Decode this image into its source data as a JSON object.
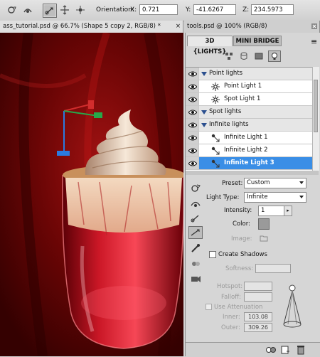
{
  "options_bar": {
    "orientation_label": "Orientation:",
    "x_label": "X:",
    "x_value": "0.721",
    "y_label": "Y:",
    "y_value": "-41.6267",
    "z_label": "Z:",
    "z_value": "234.5973"
  },
  "tabs": {
    "document": "ass_tutorial.psd @ 66.7% (Shape 5 copy 2, RGB/8) *",
    "document_close": "×",
    "tools": "tools.psd @ 100% (RGB/8)"
  },
  "panel": {
    "tab_3d": "3D {LIGHTS}",
    "tab_mini_bridge": "MINI BRIDGE",
    "menu_glyph": "≡",
    "lights": [
      {
        "label": "Point lights",
        "type": "group",
        "selected": false
      },
      {
        "label": "Point Light 1",
        "type": "point",
        "selected": false
      },
      {
        "label": "Spot Light 1",
        "type": "spot",
        "selected": false
      },
      {
        "label": "Spot lights",
        "type": "group",
        "selected": false
      },
      {
        "label": "Infinite lights",
        "type": "group",
        "selected": false
      },
      {
        "label": "Infinite Light 1",
        "type": "infinite",
        "selected": false
      },
      {
        "label": "Infinite Light 2",
        "type": "infinite",
        "selected": false
      },
      {
        "label": "Infinite Light 3",
        "type": "infinite",
        "selected": true
      }
    ],
    "properties": {
      "preset_label": "Preset:",
      "preset_value": "Custom",
      "light_type_label": "Light Type:",
      "light_type_value": "Infinite",
      "intensity_label": "Intensity:",
      "intensity_value": "1",
      "color_label": "Color:",
      "color_swatch": "#9a9a9a",
      "image_label": "Image:",
      "create_shadows_label": "Create Shadows",
      "softness_label": "Softness:",
      "hotspot_label": "Hotspot:",
      "falloff_label": "Falloff:",
      "use_attenuation_label": "Use Attenuation",
      "inner_label": "Inner:",
      "inner_value": "103.08",
      "outer_label": "Outer:",
      "outer_value": "309.26"
    }
  },
  "colors": {
    "selection": "#3a8ee6",
    "canvas_red": "#7a0808"
  }
}
